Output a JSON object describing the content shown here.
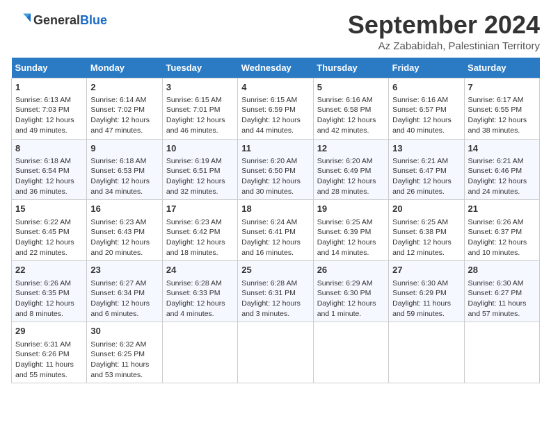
{
  "header": {
    "logo_general": "General",
    "logo_blue": "Blue",
    "month_title": "September 2024",
    "location": "Az Zababidah, Palestinian Territory"
  },
  "days_of_week": [
    "Sunday",
    "Monday",
    "Tuesday",
    "Wednesday",
    "Thursday",
    "Friday",
    "Saturday"
  ],
  "weeks": [
    [
      {
        "day": "1",
        "info": "Sunrise: 6:13 AM\nSunset: 7:03 PM\nDaylight: 12 hours\nand 49 minutes."
      },
      {
        "day": "2",
        "info": "Sunrise: 6:14 AM\nSunset: 7:02 PM\nDaylight: 12 hours\nand 47 minutes."
      },
      {
        "day": "3",
        "info": "Sunrise: 6:15 AM\nSunset: 7:01 PM\nDaylight: 12 hours\nand 46 minutes."
      },
      {
        "day": "4",
        "info": "Sunrise: 6:15 AM\nSunset: 6:59 PM\nDaylight: 12 hours\nand 44 minutes."
      },
      {
        "day": "5",
        "info": "Sunrise: 6:16 AM\nSunset: 6:58 PM\nDaylight: 12 hours\nand 42 minutes."
      },
      {
        "day": "6",
        "info": "Sunrise: 6:16 AM\nSunset: 6:57 PM\nDaylight: 12 hours\nand 40 minutes."
      },
      {
        "day": "7",
        "info": "Sunrise: 6:17 AM\nSunset: 6:55 PM\nDaylight: 12 hours\nand 38 minutes."
      }
    ],
    [
      {
        "day": "8",
        "info": "Sunrise: 6:18 AM\nSunset: 6:54 PM\nDaylight: 12 hours\nand 36 minutes."
      },
      {
        "day": "9",
        "info": "Sunrise: 6:18 AM\nSunset: 6:53 PM\nDaylight: 12 hours\nand 34 minutes."
      },
      {
        "day": "10",
        "info": "Sunrise: 6:19 AM\nSunset: 6:51 PM\nDaylight: 12 hours\nand 32 minutes."
      },
      {
        "day": "11",
        "info": "Sunrise: 6:20 AM\nSunset: 6:50 PM\nDaylight: 12 hours\nand 30 minutes."
      },
      {
        "day": "12",
        "info": "Sunrise: 6:20 AM\nSunset: 6:49 PM\nDaylight: 12 hours\nand 28 minutes."
      },
      {
        "day": "13",
        "info": "Sunrise: 6:21 AM\nSunset: 6:47 PM\nDaylight: 12 hours\nand 26 minutes."
      },
      {
        "day": "14",
        "info": "Sunrise: 6:21 AM\nSunset: 6:46 PM\nDaylight: 12 hours\nand 24 minutes."
      }
    ],
    [
      {
        "day": "15",
        "info": "Sunrise: 6:22 AM\nSunset: 6:45 PM\nDaylight: 12 hours\nand 22 minutes."
      },
      {
        "day": "16",
        "info": "Sunrise: 6:23 AM\nSunset: 6:43 PM\nDaylight: 12 hours\nand 20 minutes."
      },
      {
        "day": "17",
        "info": "Sunrise: 6:23 AM\nSunset: 6:42 PM\nDaylight: 12 hours\nand 18 minutes."
      },
      {
        "day": "18",
        "info": "Sunrise: 6:24 AM\nSunset: 6:41 PM\nDaylight: 12 hours\nand 16 minutes."
      },
      {
        "day": "19",
        "info": "Sunrise: 6:25 AM\nSunset: 6:39 PM\nDaylight: 12 hours\nand 14 minutes."
      },
      {
        "day": "20",
        "info": "Sunrise: 6:25 AM\nSunset: 6:38 PM\nDaylight: 12 hours\nand 12 minutes."
      },
      {
        "day": "21",
        "info": "Sunrise: 6:26 AM\nSunset: 6:37 PM\nDaylight: 12 hours\nand 10 minutes."
      }
    ],
    [
      {
        "day": "22",
        "info": "Sunrise: 6:26 AM\nSunset: 6:35 PM\nDaylight: 12 hours\nand 8 minutes."
      },
      {
        "day": "23",
        "info": "Sunrise: 6:27 AM\nSunset: 6:34 PM\nDaylight: 12 hours\nand 6 minutes."
      },
      {
        "day": "24",
        "info": "Sunrise: 6:28 AM\nSunset: 6:33 PM\nDaylight: 12 hours\nand 4 minutes."
      },
      {
        "day": "25",
        "info": "Sunrise: 6:28 AM\nSunset: 6:31 PM\nDaylight: 12 hours\nand 3 minutes."
      },
      {
        "day": "26",
        "info": "Sunrise: 6:29 AM\nSunset: 6:30 PM\nDaylight: 12 hours\nand 1 minute."
      },
      {
        "day": "27",
        "info": "Sunrise: 6:30 AM\nSunset: 6:29 PM\nDaylight: 11 hours\nand 59 minutes."
      },
      {
        "day": "28",
        "info": "Sunrise: 6:30 AM\nSunset: 6:27 PM\nDaylight: 11 hours\nand 57 minutes."
      }
    ],
    [
      {
        "day": "29",
        "info": "Sunrise: 6:31 AM\nSunset: 6:26 PM\nDaylight: 11 hours\nand 55 minutes."
      },
      {
        "day": "30",
        "info": "Sunrise: 6:32 AM\nSunset: 6:25 PM\nDaylight: 11 hours\nand 53 minutes."
      },
      {
        "day": "",
        "info": ""
      },
      {
        "day": "",
        "info": ""
      },
      {
        "day": "",
        "info": ""
      },
      {
        "day": "",
        "info": ""
      },
      {
        "day": "",
        "info": ""
      }
    ]
  ]
}
